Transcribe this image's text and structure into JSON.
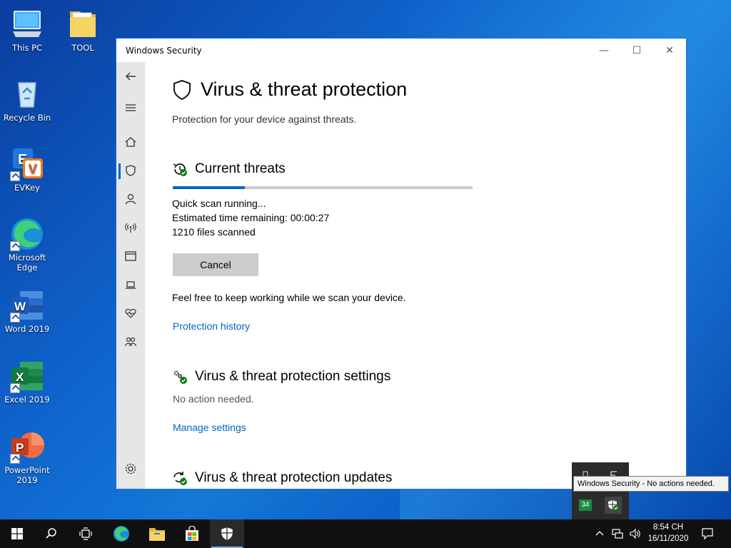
{
  "desktop": {
    "icons": [
      {
        "label": "This PC",
        "icon": "computer-icon"
      },
      {
        "label": "TOOL",
        "icon": "folder-icon"
      },
      {
        "label": "Recycle Bin",
        "icon": "recycle-bin-icon"
      },
      {
        "label": "EVKey",
        "icon": "evkey-icon"
      },
      {
        "label": "Microsoft Edge",
        "icon": "edge-icon"
      },
      {
        "label": "Word 2019",
        "icon": "word-icon"
      },
      {
        "label": "Excel 2019",
        "icon": "excel-icon"
      },
      {
        "label": "PowerPoint 2019",
        "icon": "powerpoint-icon"
      }
    ]
  },
  "window": {
    "title": "Windows Security",
    "controls": {
      "minimize": "—",
      "maximize": "☐",
      "close": "✕"
    }
  },
  "page": {
    "title": "Virus & threat protection",
    "subtitle": "Protection for your device against threats."
  },
  "current_threats": {
    "heading": "Current threats",
    "progress_fraction": 0.24,
    "status": "Quick scan running...",
    "time_remaining_label": "Estimated time remaining:",
    "time_remaining": "00:00:27",
    "files_count": "1210",
    "files_label": "files scanned",
    "cancel_label": "Cancel",
    "info": "Feel free to keep working while we scan your device.",
    "history_link": "Protection history"
  },
  "settings": {
    "heading": "Virus & threat protection settings",
    "status": "No action needed.",
    "manage_link": "Manage settings"
  },
  "updates": {
    "heading": "Virus & threat protection updates"
  },
  "tray_popup": {
    "badge": "34",
    "tooltip": "Windows Security - No actions needed."
  },
  "taskbar": {
    "time": "8:54 CH",
    "date": "16/11/2020"
  },
  "colors": {
    "accent": "#0067c0",
    "nav_bg": "#e6e6e6",
    "taskbar": "#101010",
    "ok_green": "#107c10"
  }
}
